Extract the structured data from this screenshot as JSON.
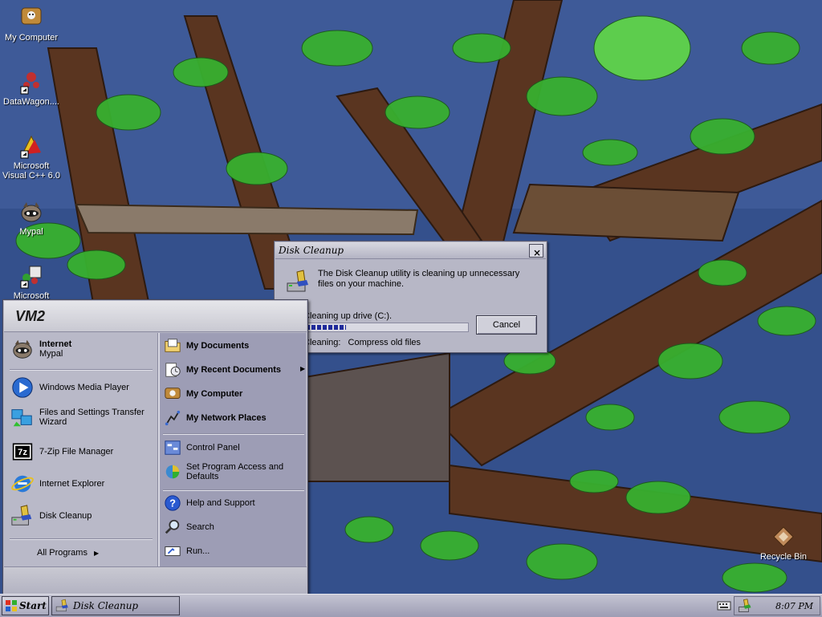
{
  "desktop": {
    "icons": [
      {
        "label": "My Computer",
        "icon": "my-computer-icon"
      },
      {
        "label": "DataWagon....",
        "icon": "datawagon-icon"
      },
      {
        "label": "Microsoft Visual C++ 6.0",
        "icon": "visual-cpp-icon"
      },
      {
        "label": "Mypal",
        "icon": "mypal-icon"
      },
      {
        "label": "Microsoft Visual",
        "icon": "visual-studio-icon"
      },
      {
        "label": "Recycle Bin",
        "icon": "recycle-bin-icon"
      }
    ]
  },
  "start_menu": {
    "user": "VM2",
    "pinned": [
      {
        "title": "Internet",
        "subtitle": "Mypal",
        "icon": "mypal-icon"
      }
    ],
    "recent": [
      {
        "label": "Windows Media Player",
        "icon": "media-player-icon"
      },
      {
        "label": "Files and Settings Transfer Wizard",
        "icon": "transfer-wizard-icon"
      },
      {
        "label": "7-Zip File Manager",
        "icon": "7zip-icon"
      },
      {
        "label": "Internet Explorer",
        "icon": "internet-explorer-icon"
      },
      {
        "label": "Disk Cleanup",
        "icon": "disk-cleanup-icon"
      }
    ],
    "all_programs": "All Programs",
    "right_places": [
      {
        "label": "My Documents",
        "icon": "my-documents-icon"
      },
      {
        "label": "My Recent Documents",
        "icon": "recent-documents-icon"
      },
      {
        "label": "My Computer",
        "icon": "my-computer-icon"
      },
      {
        "label": "My Network Places",
        "icon": "network-places-icon"
      }
    ],
    "right_settings": [
      {
        "label": "Control Panel",
        "icon": "control-panel-icon"
      },
      {
        "label": "Set Program Access and Defaults",
        "icon": "program-access-icon"
      }
    ],
    "right_help": [
      {
        "label": "Help and Support",
        "icon": "help-icon"
      },
      {
        "label": "Search",
        "icon": "search-icon"
      },
      {
        "label": "Run...",
        "icon": "run-icon"
      }
    ]
  },
  "dialog": {
    "title": "Disk Cleanup",
    "message": "The Disk Cleanup utility is cleaning up unnecessary files on your machine.",
    "cleaning_label": "Cleaning up drive  (C:).",
    "progress_percent": 25,
    "status_label": "Cleaning:",
    "status_value": "Compress old files",
    "cancel_label": "Cancel",
    "close_label": "×"
  },
  "taskbar": {
    "start_label": "Start",
    "task_label": "Disk Cleanup",
    "clock": "8:07 PM"
  }
}
